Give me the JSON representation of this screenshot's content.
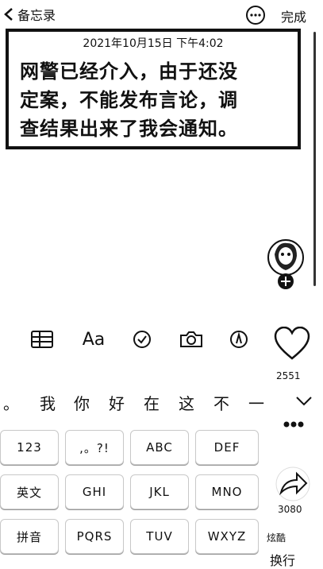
{
  "nav": {
    "back_label": "备忘录",
    "done_label": "完成"
  },
  "note": {
    "timestamp": "2021年10月15日 下午4:02",
    "line1": "网警已经介入，由于还没",
    "line2": "定案，不能发布言论，调",
    "line3": "查结果出来了我会通知。"
  },
  "toolbar": {
    "table_icon": "table-icon",
    "format_label": "Aa",
    "checklist_icon": "checklist-icon",
    "camera_icon": "camera-icon",
    "markup_icon": "pen-icon",
    "heart_icon": "heart-icon"
  },
  "candidates": [
    "。",
    "我",
    "你",
    "好",
    "在",
    "这",
    "不",
    "一"
  ],
  "overlay": {
    "heart_count": "2551",
    "share_count": "3080",
    "watermark": "炫酷"
  },
  "keyboard": {
    "row1": [
      "123",
      ",。?!",
      "ABC",
      "DEF"
    ],
    "row2": [
      "英文",
      "GHI",
      "JKL",
      "MNO"
    ],
    "row3": [
      "拼音",
      "PQRS",
      "TUV",
      "WXYZ"
    ],
    "return_label": "换行"
  }
}
